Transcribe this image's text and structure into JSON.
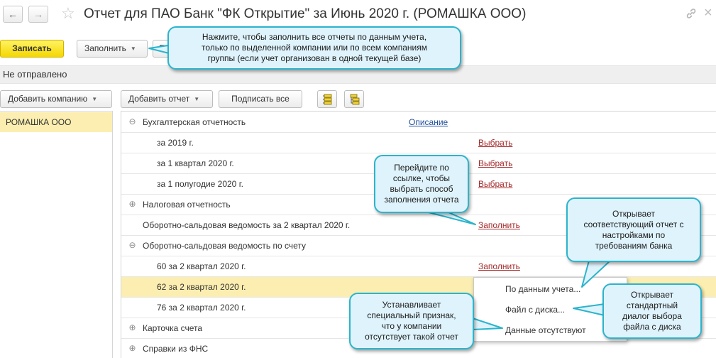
{
  "window": {
    "back_label": "←",
    "forward_label": "→",
    "title": "Отчет для ПАО Банк \"ФК Открытие\" за Июнь 2020 г. (РОМАШКА ООО)",
    "close_label": "×"
  },
  "toolbar": {
    "save_label": "Записать",
    "fill_label": "Заполнить",
    "hidden_label": "П"
  },
  "status": {
    "text": "Не отправлено"
  },
  "companies": {
    "add_label": "Добавить компанию",
    "items": [
      "РОМАШКА ООО"
    ]
  },
  "reports": {
    "add_label": "Добавить отчет",
    "sign_all_label": "Подписать все",
    "rows": [
      {
        "toggle": "⊖",
        "label": "Бухгалтерская отчетность",
        "action": "Описание",
        "level": 0
      },
      {
        "toggle": "",
        "label": "за 2019 г.",
        "action": "Выбрать",
        "level": 1
      },
      {
        "toggle": "",
        "label": "за 1 квартал 2020 г.",
        "action": "Выбрать",
        "level": 1
      },
      {
        "toggle": "",
        "label": "за 1 полугодие 2020 г.",
        "action": "Выбрать",
        "level": 1
      },
      {
        "toggle": "⊕",
        "label": "Налоговая отчетность",
        "action": "",
        "level": 0
      },
      {
        "toggle": "",
        "label": "Оборотно-сальдовая ведомость за 2 квартал 2020 г.",
        "action": "Заполнить",
        "level": 0
      },
      {
        "toggle": "⊖",
        "label": "Оборотно-сальдовая ведомость по счету",
        "action": "",
        "level": 0
      },
      {
        "toggle": "",
        "label": "60 за 2 квартал 2020 г.",
        "action": "Заполнить",
        "level": 1
      },
      {
        "toggle": "",
        "label": "62 за 2 квартал 2020 г.",
        "action": "",
        "level": 1
      },
      {
        "toggle": "",
        "label": "76 за 2 квартал 2020 г.",
        "action": "",
        "level": 1
      },
      {
        "toggle": "⊕",
        "label": "Карточка счета",
        "action": "",
        "level": 0
      },
      {
        "toggle": "⊕",
        "label": "Справки из ФНС",
        "action": "",
        "level": 0
      }
    ],
    "selected_row": 8
  },
  "fill_menu": {
    "items": [
      "По данным учета...",
      "Файл с диска...",
      "Данные отсутствуют"
    ]
  },
  "callouts": {
    "fill_button": [
      "Нажмите, чтобы заполнить все отчеты по данным учета,",
      "только по выделенной компании или по всем компаниям",
      "группы (если учет организован в одной текущей базе)"
    ],
    "fill_link": [
      "Перейдите по",
      "ссылке, чтобы",
      "выбрать способ",
      "заполнения отчета"
    ],
    "by_accounting": [
      "Открывает",
      "соответствующий отчет с",
      "настройками по",
      "требованиям банка"
    ],
    "from_disk": [
      "Открывает",
      "стандартный",
      "диалог выбора",
      "файла с диска"
    ],
    "no_data": [
      "Устанавливает",
      "специальный признак,",
      "что у компании",
      "отсутствует такой отчет"
    ]
  },
  "colors": {
    "accent_yellow": "#f4d700",
    "selection": "#fbeeb0",
    "link_red": "#a52a2a",
    "link_blue": "#1e4e9a",
    "callout_border": "#2bb4cc",
    "callout_fill": "#dff3fc"
  }
}
